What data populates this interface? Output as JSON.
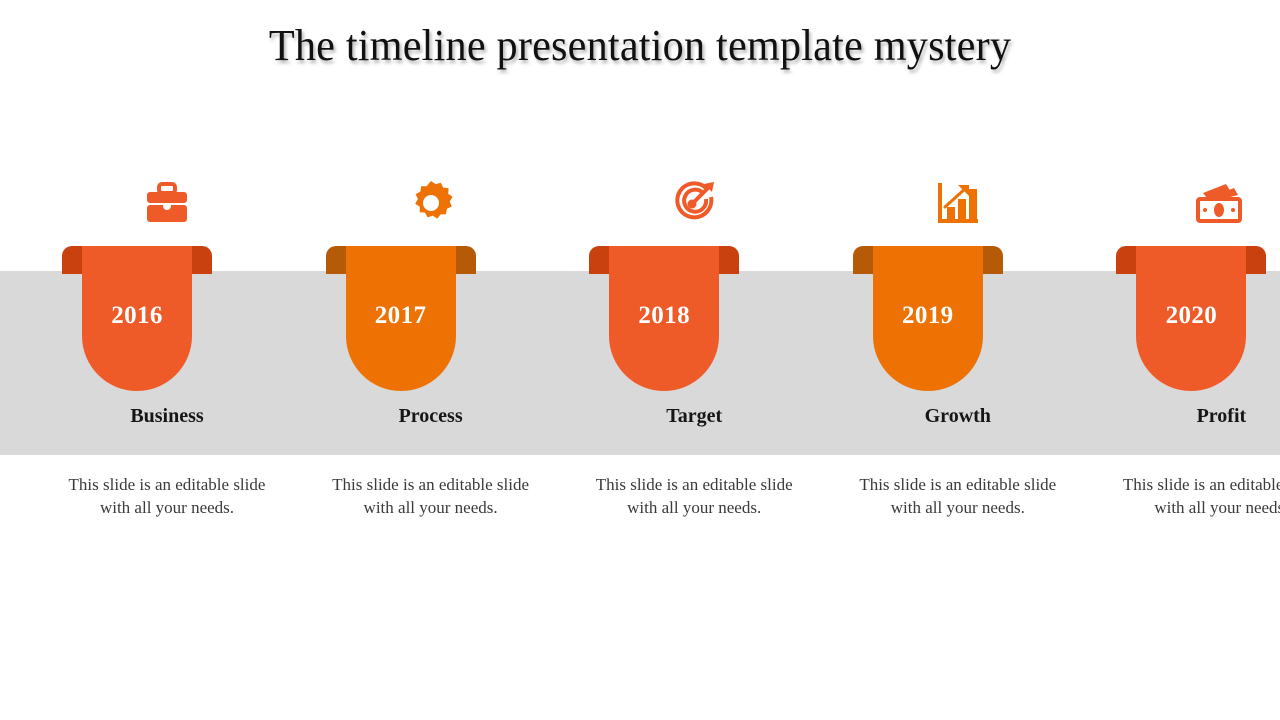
{
  "slide": {
    "title": "The timeline presentation template mystery",
    "background_color": "#ffffff",
    "band_color": "#d9d9d9"
  },
  "palette": {
    "red_orange": "#ef5b28",
    "red_orange_dark": "#c8410e",
    "bright_orange": "#ed7203",
    "bright_orange_dark": "#b55a06",
    "year_text": "#ffffff",
    "label_text": "#161616",
    "desc_text": "#3a3a3a"
  },
  "steps": [
    {
      "year": "2016",
      "label": "Business",
      "description": "This slide is an editable slide with all your needs.",
      "icon": "briefcase-icon",
      "color": "#ef5b28",
      "color_dark": "#c8410e"
    },
    {
      "year": "2017",
      "label": "Process",
      "description": "This slide is an editable slide with all your needs.",
      "icon": "gear-icon",
      "color": "#ed7203",
      "color_dark": "#b55a06"
    },
    {
      "year": "2018",
      "label": "Target",
      "description": "This slide is an editable slide with all your needs.",
      "icon": "target-arrow-icon",
      "color": "#ef5b28",
      "color_dark": "#c8410e"
    },
    {
      "year": "2019",
      "label": "Growth",
      "description": "This slide is an editable slide with all your needs.",
      "icon": "bar-chart-growth-icon",
      "color": "#ed7203",
      "color_dark": "#b55a06"
    },
    {
      "year": "2020",
      "label": "Profit",
      "description": "This slide is an editable slide with all your needs.",
      "icon": "money-cash-icon",
      "color": "#ef5b28",
      "color_dark": "#c8410e"
    }
  ]
}
